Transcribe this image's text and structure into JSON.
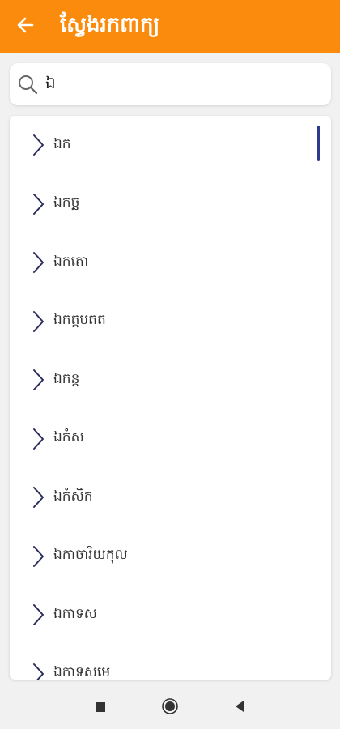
{
  "appbar": {
    "title": "ស្វែងរកពាក្យ",
    "back_icon": "arrow-left-icon",
    "color": "#fb8b0c"
  },
  "search": {
    "value": "ឯ",
    "icon": "search-icon"
  },
  "results": {
    "items": [
      {
        "label": "ឯក"
      },
      {
        "label": "ឯកច្ឆ"
      },
      {
        "label": "ឯកតោ"
      },
      {
        "label": "ឯកត្តបតត"
      },
      {
        "label": "ឯកន្ត"
      },
      {
        "label": "ឯកំស"
      },
      {
        "label": "ឯកំសិក"
      },
      {
        "label": "ឯកាចារិយកុល"
      },
      {
        "label": "ឯកាទស"
      },
      {
        "label": "ឯកាទសមេ"
      }
    ],
    "item_icon": "chevron-right-icon",
    "scrollbar_color": "#2e3a8c"
  },
  "navbar": {
    "recents_icon": "square-icon",
    "home_icon": "circle-icon",
    "back_icon": "triangle-left-icon"
  }
}
